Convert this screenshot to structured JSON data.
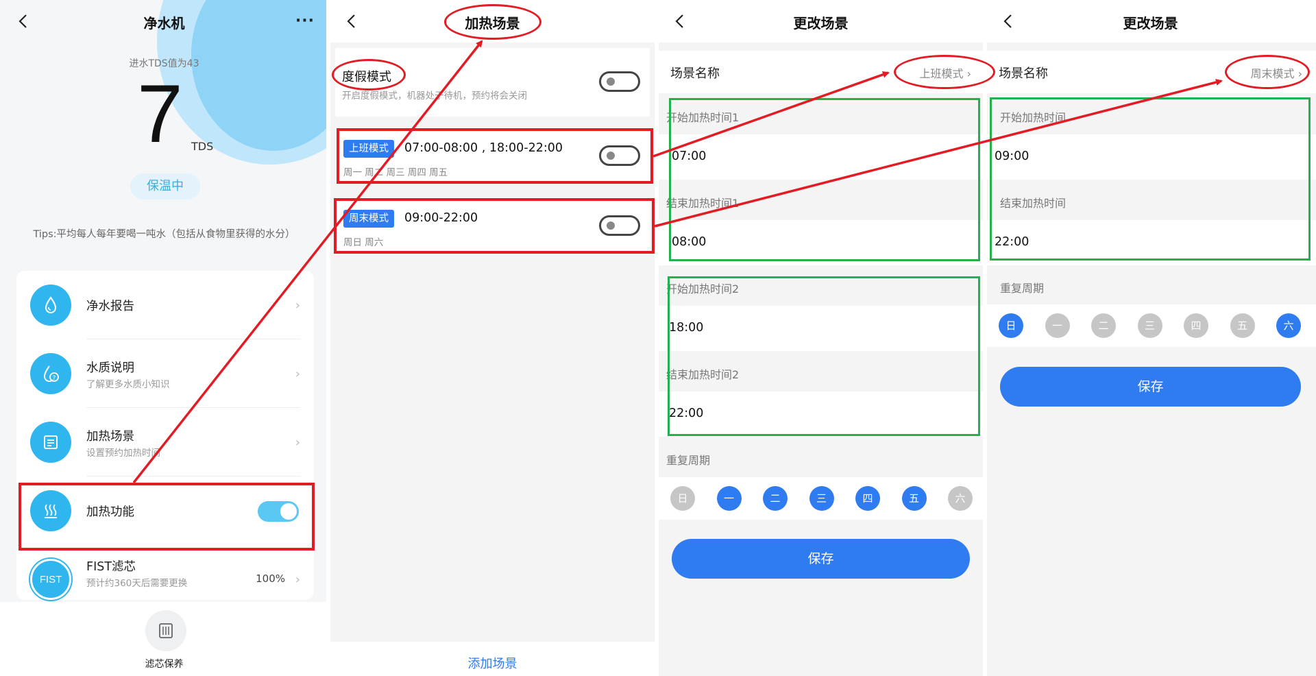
{
  "panel1": {
    "title": "净水机",
    "more": "···",
    "tds_label": "进水TDS值为43",
    "tds_value": "7",
    "tds_unit": "TDS",
    "status": "保温中",
    "tips": "Tips:平均每人每年要喝一吨水（包括从食物里获得的水分）",
    "menu": [
      {
        "title": "净水报告",
        "sub": "",
        "icon": "water-drop-icon"
      },
      {
        "title": "水质说明",
        "sub": "了解更多水质小知识",
        "icon": "water-question-icon"
      },
      {
        "title": "加热场景",
        "sub": "设置预约加热时间",
        "icon": "schedule-list-icon"
      },
      {
        "title": "加热功能",
        "sub": "",
        "icon": "heat-waves-icon",
        "toggle": "on"
      },
      {
        "title": "FIST滤芯",
        "sub": "预计约360天后需要更换",
        "icon": "fist-filter-icon",
        "value": "100%"
      }
    ],
    "fist_icon_text": "FIST",
    "bottom_label": "滤芯保养"
  },
  "panel2": {
    "title": "加热场景",
    "vacation": {
      "title": "度假模式",
      "desc": "开启度假模式，机器处于待机，预约将会关闭"
    },
    "scenes": [
      {
        "tag": "上班模式",
        "times": "07:00-08:00 , 18:00-22:00",
        "days": "周一 周二 周三 周四 周五"
      },
      {
        "tag": "周末模式",
        "times": "09:00-22:00",
        "days": "周日 周六"
      }
    ],
    "add_label": "添加场景"
  },
  "panel3": {
    "title": "更改场景",
    "name_label": "场景名称",
    "name_value": "上班模式",
    "start1_label": "开始加热时间1",
    "start1_value": "07:00",
    "end1_label": "结束加热时间1",
    "end1_value": "08:00",
    "start2_label": "开始加热时间2",
    "start2_value": "18:00",
    "end2_label": "结束加热时间2",
    "end2_value": "22:00",
    "repeat_label": "重复周期",
    "weekdays": [
      "日",
      "一",
      "二",
      "三",
      "四",
      "五",
      "六"
    ],
    "active_days": [
      false,
      true,
      true,
      true,
      true,
      true,
      false
    ],
    "save_label": "保存"
  },
  "panel4": {
    "title": "更改场景",
    "name_label": "场景名称",
    "name_value": "周末模式",
    "start_label": "开始加热时间",
    "start_value": "09:00",
    "end_label": "结束加热时间",
    "end_value": "22:00",
    "repeat_label": "重复周期",
    "weekdays": [
      "日",
      "一",
      "二",
      "三",
      "四",
      "五",
      "六"
    ],
    "active_days": [
      true,
      false,
      false,
      false,
      false,
      false,
      true
    ],
    "save_label": "保存"
  },
  "colors": {
    "accent": "#2f7bf0",
    "cyan": "#2fb6ee",
    "annotation_red": "#e21c24",
    "annotation_green": "#22b14c"
  }
}
